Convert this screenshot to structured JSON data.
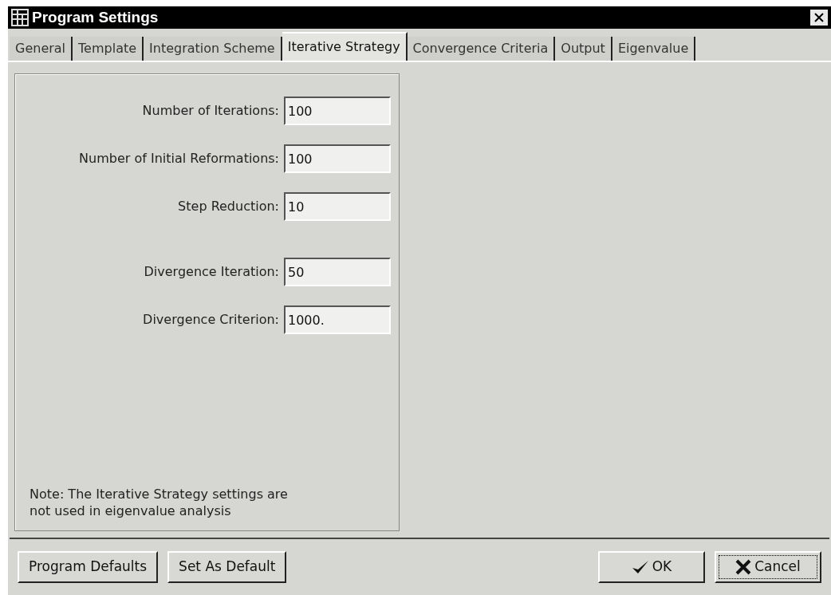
{
  "window": {
    "title": "Program Settings"
  },
  "tabs": [
    {
      "label": "General",
      "selected": false
    },
    {
      "label": "Template",
      "selected": false
    },
    {
      "label": "Integration Scheme",
      "selected": false
    },
    {
      "label": "Iterative Strategy",
      "selected": true
    },
    {
      "label": "Convergence Criteria",
      "selected": false
    },
    {
      "label": "Output",
      "selected": false
    },
    {
      "label": "Eigenvalue",
      "selected": false
    }
  ],
  "fields": [
    {
      "label": "Number of Iterations:",
      "value": "100"
    },
    {
      "label": "Number of Initial Reformations:",
      "value": "100"
    },
    {
      "label": "Step Reduction:",
      "value": "10"
    },
    {
      "label": "Divergence Iteration:",
      "value": "50"
    },
    {
      "label": "Divergence Criterion:",
      "value": "1000."
    }
  ],
  "note": "Note: The Iterative Strategy settings are not used in eigenvalue analysis",
  "buttons": [
    {
      "label": "Program Defaults",
      "kind": "plain"
    },
    {
      "label": "Set As Default",
      "kind": "plain"
    },
    {
      "label": "OK",
      "kind": "ok"
    },
    {
      "label": "Cancel",
      "kind": "cancel"
    }
  ]
}
